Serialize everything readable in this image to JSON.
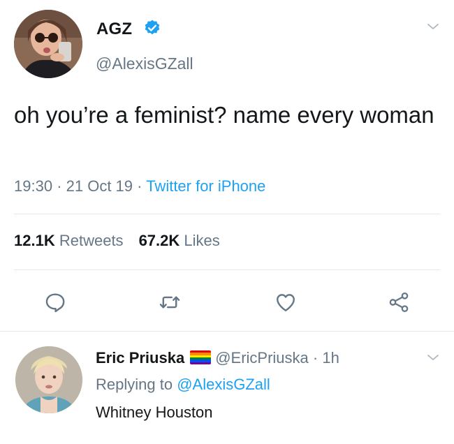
{
  "tweet": {
    "author": {
      "name": "AGZ",
      "handle": "@AlexisGZall",
      "verified": true,
      "avatar": "avatar-woman-sunglasses"
    },
    "text": "oh you’re a feminist? name every woman",
    "time": "19:30",
    "date": "21 Oct 19",
    "separator": "·",
    "source": "Twitter for iPhone",
    "retweets_count": "12.1K",
    "retweets_label": "Retweets",
    "likes_count": "67.2K",
    "likes_label": "Likes",
    "actions": [
      "reply-icon",
      "retweet-icon",
      "like-icon",
      "share-icon"
    ]
  },
  "reply": {
    "author": {
      "name": "Eric Priuska",
      "handle": "@EricPriuska",
      "badge": "rainbow-flag",
      "avatar": "avatar-man-blond"
    },
    "age": "1h",
    "separator": "·",
    "replying_prefix": "Replying to",
    "replying_to": "@AlexisGZall",
    "text": "Whitney Houston"
  },
  "colors": {
    "accent": "#1da1f2",
    "text": "#14171a",
    "muted": "#657786",
    "divider": "#e1e8ed",
    "rainbow": [
      "#e40303",
      "#ff8c00",
      "#ffed00",
      "#008026",
      "#004dff",
      "#750787"
    ]
  }
}
